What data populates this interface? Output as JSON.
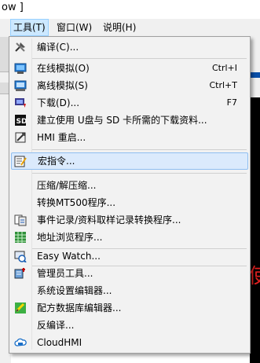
{
  "window": {
    "title_fragment": "ow ]"
  },
  "menubar": {
    "items": [
      {
        "label": "工具(T)",
        "active": true
      },
      {
        "label": "窗口(W)",
        "active": false
      },
      {
        "label": "说明(H)",
        "active": false
      }
    ]
  },
  "menu": {
    "items": [
      {
        "icon": "compile-icon",
        "label": "编译(C)...",
        "shortcut": ""
      },
      {
        "icon": "online-simulation-icon",
        "label": "在线模拟(O)",
        "shortcut": "Ctrl+I"
      },
      {
        "icon": "offline-simulation-icon",
        "label": "离线模拟(S)",
        "shortcut": "Ctrl+T"
      },
      {
        "icon": "download-icon",
        "label": "下载(D)...",
        "shortcut": "F7"
      },
      {
        "icon": "sd-card-icon",
        "label": "建立使用 U盘与 SD 卡所需的下载资料...",
        "shortcut": ""
      },
      {
        "icon": "hmi-restart-icon",
        "label": "HMI 重启...",
        "shortcut": ""
      },
      {
        "icon": "macro-icon",
        "label": "宏指令...",
        "shortcut": "",
        "highlighted": true
      },
      {
        "icon": "",
        "label": "压缩/解压缩...",
        "shortcut": ""
      },
      {
        "icon": "",
        "label": "转换MT500程序...",
        "shortcut": ""
      },
      {
        "icon": "event-log-convert-icon",
        "label": "事件记录/资料取样记录转换程序...",
        "shortcut": ""
      },
      {
        "icon": "address-browse-icon",
        "label": "地址浏览程序...",
        "shortcut": ""
      },
      {
        "icon": "easy-watch-icon",
        "label": "Easy Watch...",
        "shortcut": ""
      },
      {
        "icon": "admin-tool-icon",
        "label": "管理员工具...",
        "shortcut": ""
      },
      {
        "icon": "",
        "label": "系统设置编辑器...",
        "shortcut": ""
      },
      {
        "icon": "recipe-db-icon",
        "label": "配方数据库编辑器...",
        "shortcut": ""
      },
      {
        "icon": "",
        "label": "反编译...",
        "shortcut": ""
      },
      {
        "icon": "cloudhmi-icon",
        "label": "CloudHMI",
        "shortcut": ""
      }
    ]
  },
  "background": {
    "red_glyph": "使"
  }
}
